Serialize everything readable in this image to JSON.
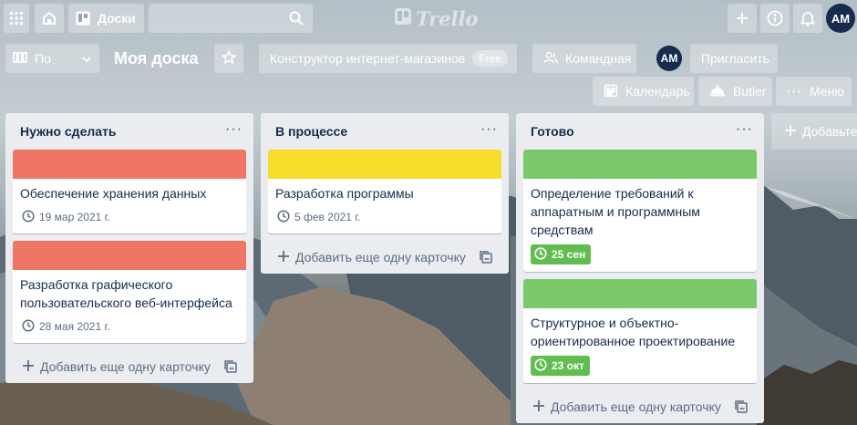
{
  "app": {
    "logo_text": "Trello"
  },
  "header": {
    "apps_icon": "grid-icon",
    "home_icon": "home-icon",
    "boards_label": "Доски",
    "search_placeholder": "",
    "user_initials": "AM"
  },
  "board": {
    "view_label": "По",
    "title": "Моя доска",
    "workspace_label": "Конструктор интернет-магазинов",
    "workspace_badge": "Free",
    "visibility_label": "Командная",
    "member_initials": "AM",
    "invite_label": "Пригласить",
    "calendar_label": "Календарь",
    "butler_label": "Butler",
    "menu_label": "Меню"
  },
  "lists": [
    {
      "title": "Нужно сделать",
      "add_label": "Добавить еще одну карточку",
      "cards": [
        {
          "cover": "#eb5a46",
          "title": "Обеспечение хранения данных",
          "due": "19 мар 2021 г.",
          "due_complete": false
        },
        {
          "cover": "#eb5a46",
          "title": "Разработка графического пользовательского веб-интерфейса",
          "due": "28 мая 2021 г.",
          "due_complete": false
        }
      ]
    },
    {
      "title": "В процессе",
      "add_label": "Добавить еще одну карточку",
      "cards": [
        {
          "cover": "#f2d600",
          "title": "Разработка программы",
          "due": "5 фев 2021 г.",
          "due_complete": false
        }
      ]
    },
    {
      "title": "Готово",
      "add_label": "Добавить еще одну карточку",
      "cards": [
        {
          "cover": "#61bd4f",
          "title": "Определение требований к аппаратным и программным средствам",
          "due": "25 сен",
          "due_complete": true
        },
        {
          "cover": "#61bd4f",
          "title": "Структурное и объектно-ориентированное проектирование",
          "due": "23 окт",
          "due_complete": true
        }
      ]
    }
  ],
  "add_list_label": "Добавьте"
}
